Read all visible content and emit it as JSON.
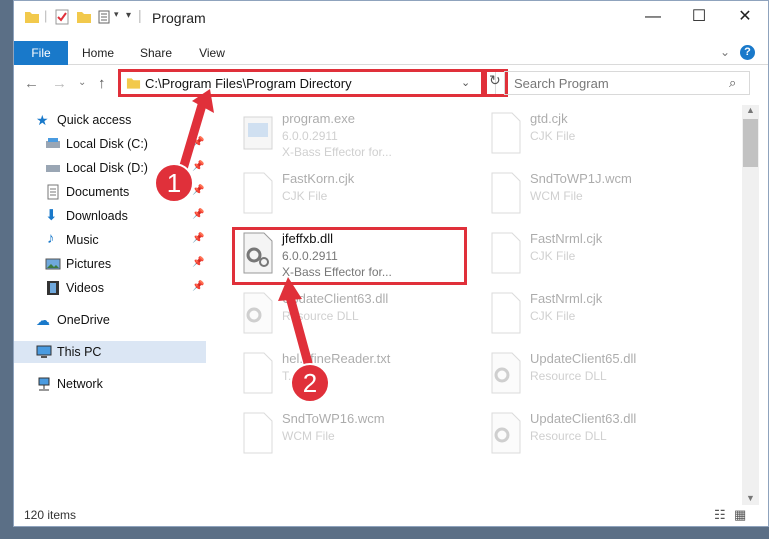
{
  "window": {
    "title": "Program"
  },
  "ribbon": {
    "tabs": [
      "File",
      "Home",
      "Share",
      "View"
    ]
  },
  "address": {
    "path": "C:\\Program Files\\Program Directory"
  },
  "search": {
    "placeholder": "Search Program"
  },
  "nav": {
    "items": [
      {
        "label": "Quick access",
        "icon": "star-icon"
      },
      {
        "label": "Local Disk (C:)",
        "icon": "drive-icon"
      },
      {
        "label": "Local Disk (D:)",
        "icon": "drive-icon"
      },
      {
        "label": "Documents",
        "icon": "documents-icon"
      },
      {
        "label": "Downloads",
        "icon": "download-icon"
      },
      {
        "label": "Music",
        "icon": "music-icon"
      },
      {
        "label": "Pictures",
        "icon": "pictures-icon"
      },
      {
        "label": "Videos",
        "icon": "videos-icon"
      },
      {
        "label": "OneDrive",
        "icon": "cloud-icon"
      },
      {
        "label": "This PC",
        "icon": "pc-icon"
      },
      {
        "label": "Network",
        "icon": "network-icon"
      }
    ]
  },
  "files": [
    {
      "name": "program.exe",
      "line2": "6.0.0.2911",
      "line3": "X-Bass Effector for...",
      "icon": "exe-icon"
    },
    {
      "name": "gtd.cjk",
      "line2": "CJK File",
      "line3": "",
      "icon": "file-icon"
    },
    {
      "name": "FastKorn.cjk",
      "line2": "CJK File",
      "line3": "",
      "icon": "file-icon"
    },
    {
      "name": "SndToWP1J.wcm",
      "line2": "WCM File",
      "line3": "",
      "icon": "file-icon"
    },
    {
      "name": "jfeffxb.dll",
      "line2": "6.0.0.2911",
      "line3": "X-Bass Effector for...",
      "icon": "dll-icon"
    },
    {
      "name": "FastNrml.cjk",
      "line2": "CJK File",
      "line3": "",
      "icon": "file-icon"
    },
    {
      "name": "UpdateClient63.dll",
      "line2": "Resource DLL",
      "line3": "",
      "icon": "dll-icon"
    },
    {
      "name": "FastNrml.cjk",
      "line2": "CJK File",
      "line3": "",
      "icon": "file-icon"
    },
    {
      "name": "hel...fineReader.txt",
      "line2": "T...",
      "line3": "",
      "icon": "file-icon"
    },
    {
      "name": "UpdateClient65.dll",
      "line2": "Resource DLL",
      "line3": "",
      "icon": "dll-icon"
    },
    {
      "name": "SndToWP16.wcm",
      "line2": "WCM File",
      "line3": "",
      "icon": "file-icon"
    },
    {
      "name": "UpdateClient63.dll",
      "line2": "Resource DLL",
      "line3": "",
      "icon": "dll-icon"
    }
  ],
  "status": {
    "items": "120 items"
  },
  "annotations": {
    "one": "1",
    "two": "2"
  },
  "colors": {
    "accent": "#1979ca",
    "highlight": "#e0303a"
  }
}
